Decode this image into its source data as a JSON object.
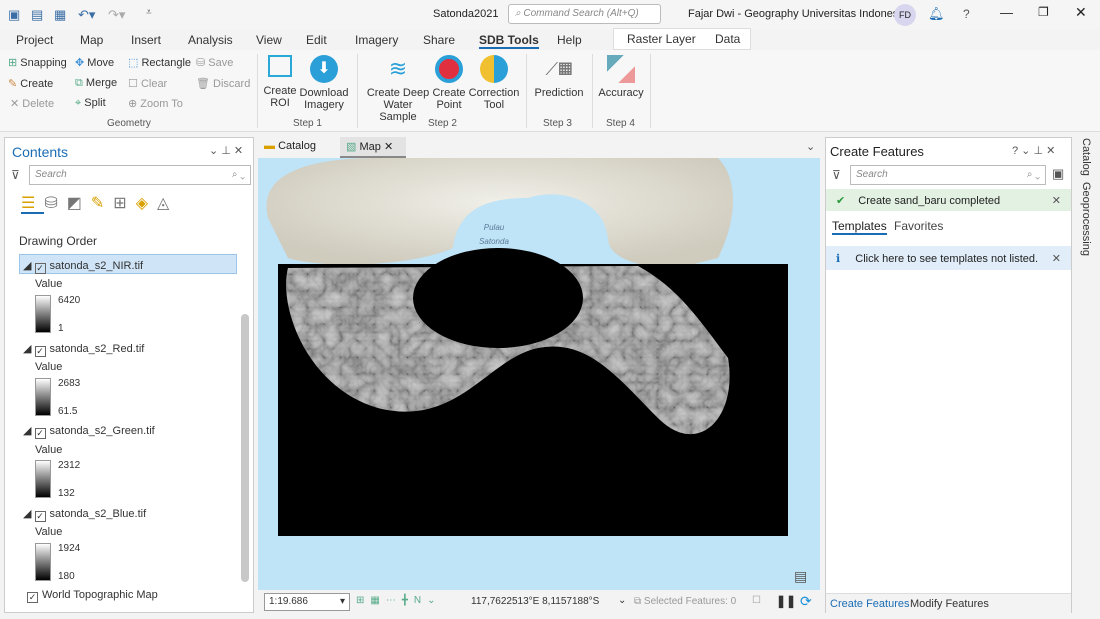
{
  "title": "Satonda2021",
  "command_search_placeholder": "Command Search (Alt+Q)",
  "user": {
    "name": "Fajar Dwi - Geography Universitas Indonesia",
    "initials": "FD"
  },
  "menu_tabs": [
    "Project",
    "Map",
    "Insert",
    "Analysis",
    "View",
    "Edit",
    "Imagery",
    "Share",
    "SDB Tools",
    "Help"
  ],
  "active_tab": "SDB Tools",
  "context_tabs": [
    "Raster Layer",
    "Data"
  ],
  "ribbon": {
    "geometry": {
      "label": "Geometry",
      "items": [
        "Snapping",
        "Move",
        "Rectangle",
        "Save",
        "Create",
        "Merge",
        "Clear",
        "Discard",
        "Delete",
        "Split",
        "Zoom To"
      ]
    },
    "step1": {
      "label": "Step 1",
      "create_roi": [
        "Create",
        "ROI"
      ],
      "download": [
        "Download",
        "Imagery"
      ]
    },
    "step2": {
      "label": "Step 2",
      "deep": [
        "Create Deep",
        "Water Sample"
      ],
      "point": [
        "Create",
        "Point"
      ],
      "correction": [
        "Correction",
        "Tool"
      ]
    },
    "step3": {
      "label": "Step 3",
      "prediction": "Prediction"
    },
    "step4": {
      "label": "Step 4",
      "accuracy": "Accuracy"
    }
  },
  "contents": {
    "title": "Contents",
    "search_placeholder": "Search",
    "drawing_order": "Drawing Order",
    "layers": [
      {
        "name": "satonda_s2_NIR.tif",
        "value_label": "Value",
        "max": "6420",
        "min": "1"
      },
      {
        "name": "satonda_s2_Red.tif",
        "value_label": "Value",
        "max": "2683",
        "min": "61.5"
      },
      {
        "name": "satonda_s2_Green.tif",
        "value_label": "Value",
        "max": "2312",
        "min": "132"
      },
      {
        "name": "satonda_s2_Blue.tif",
        "value_label": "Value",
        "max": "1924",
        "min": "180"
      }
    ],
    "basemap": "World Topographic Map"
  },
  "view_tabs": [
    "Catalog",
    "Map"
  ],
  "map": {
    "label": [
      "Pulau",
      "Satonda"
    ],
    "colors": {
      "water": "#bfe3f7",
      "land": "#e8e6dc",
      "raster_bg": "#000000"
    }
  },
  "statusbar": {
    "scale": "1:19.686",
    "coords": "117,7622513°E 8,1157188°S",
    "selected": "Selected Features: 0"
  },
  "create_features": {
    "title": "Create Features",
    "search_placeholder": "Search",
    "notice": "Create sand_baru completed",
    "tabs": [
      "Templates",
      "Favorites"
    ],
    "info": "Click here to see templates not listed.",
    "bottom_tabs": [
      "Create Features",
      "Modify Features"
    ]
  },
  "side_tabs": [
    "Catalog",
    "Geoprocessing"
  ]
}
